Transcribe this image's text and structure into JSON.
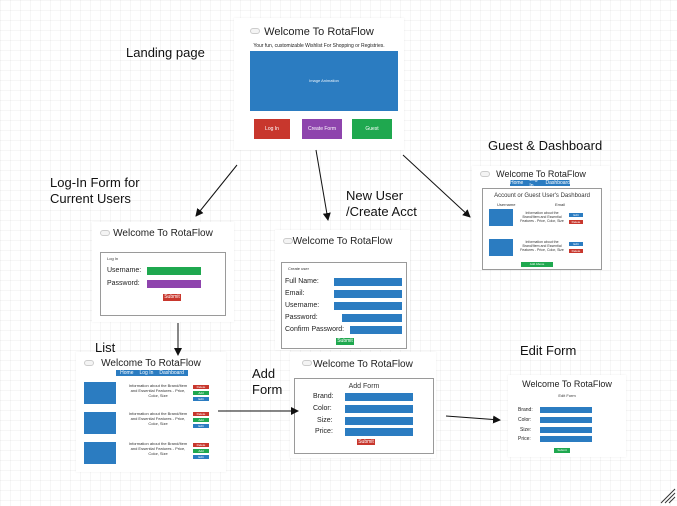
{
  "app_title": "Welcome To RotaFlow",
  "labels": {
    "landing": "Landing page",
    "login": "Log-In Form for Current Users",
    "newuser": "New User /Create Acct",
    "guest": "Guest & Dashboard",
    "list": "List",
    "addform": "Add Form",
    "editform": "Edit  Form"
  },
  "landing": {
    "subtitle": "Your fun, customizable Wishlist For Shopping or Registries.",
    "image_text": "Image Animation",
    "buttons": [
      "Log In",
      "Create Form",
      "Guest"
    ]
  },
  "login": {
    "header": "Log In",
    "username": "Username:",
    "password": "Password:",
    "submit": "Submit"
  },
  "newuser": {
    "header": "Create user",
    "fields": [
      "Full Name:",
      "Email:",
      "Username:",
      "Password:",
      "Confirm Password:"
    ],
    "submit": "Submit"
  },
  "guest": {
    "nav": [
      "Home",
      "Log In",
      "Dashboard"
    ],
    "heading": "Account or Guest User's Dashboard",
    "col1": "Username",
    "col2": "Email",
    "info": "Information about the Brand/Item and Essential Features - Price, Color, Size",
    "edit": "Edit",
    "delete": "Delete",
    "add": "Add Above"
  },
  "list": {
    "nav": [
      "Home",
      "Log In",
      "Dashboard"
    ],
    "info": "Information about the Brand/Item and Essential Features - Price, Color, Size",
    "delete": "Delete",
    "add": "Add",
    "edit": "Edit"
  },
  "addform": {
    "heading": "Add Form",
    "fields": [
      "Brand:",
      "Color:",
      "Size:",
      "Price:"
    ],
    "submit": "Submit"
  },
  "editform": {
    "heading": "Edit Form",
    "fields": [
      "Brand:",
      "Color:",
      "Size:",
      "Price:"
    ],
    "submit": "Submit"
  },
  "colors": {
    "blue": "#2b7cc1",
    "red": "#c8372d",
    "purple": "#8e44ad",
    "green": "#1fa84f"
  }
}
